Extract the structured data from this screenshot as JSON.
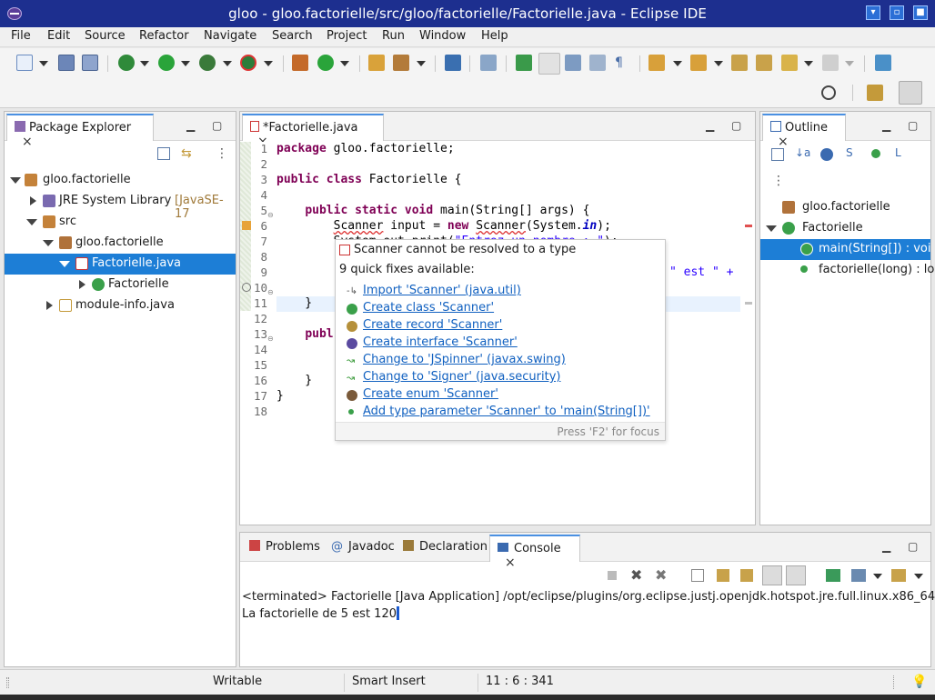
{
  "window": {
    "title": "gloo - gloo.factorielle/src/gloo/factorielle/Factorielle.java - Eclipse IDE"
  },
  "menu": [
    "File",
    "Edit",
    "Source",
    "Refactor",
    "Navigate",
    "Search",
    "Project",
    "Run",
    "Window",
    "Help"
  ],
  "package_explorer": {
    "tab_label": "Package Explorer",
    "tree": [
      {
        "label": "gloo.factorielle",
        "expanded": true
      },
      {
        "label": "JRE System Library",
        "suffix": "[JavaSE-17"
      },
      {
        "label": "src",
        "expanded": true
      },
      {
        "label": "gloo.factorielle",
        "expanded": true
      },
      {
        "label": "Factorielle.java",
        "selected": true
      },
      {
        "label": "Factorielle"
      },
      {
        "label": "module-info.java"
      }
    ]
  },
  "editor": {
    "tab_label": "*Factorielle.java",
    "line_numbers": [
      "1",
      "2",
      "3",
      "4",
      "5",
      "6",
      "7",
      "8",
      "9",
      "10",
      "11",
      "12",
      "13",
      "14",
      "15",
      "16",
      "17",
      "18"
    ],
    "partial_line9": "\" est \" +",
    "partial_line13": "publ"
  },
  "quick_fix": {
    "title": "Scanner cannot be resolved to a type",
    "subtitle": "9 quick fixes available:",
    "fixes": [
      "Import 'Scanner' (java.util)",
      "Create class 'Scanner'",
      "Create record 'Scanner'",
      "Create interface 'Scanner'",
      "Change to 'JSpinner' (javax.swing)",
      "Change to 'Signer' (java.security)",
      "Create enum 'Scanner'",
      "Add type parameter 'Scanner' to 'main(String[])'"
    ],
    "footer": "Press 'F2' for focus"
  },
  "outline": {
    "tab_label": "Outline",
    "items": [
      {
        "label": "gloo.factorielle"
      },
      {
        "label": "Factorielle"
      },
      {
        "label": "main(String[]) : voi",
        "selected": true
      },
      {
        "label": "factorielle(long) : lo"
      }
    ]
  },
  "bottom_tabs": {
    "problems": "Problems",
    "javadoc": "Javadoc",
    "declaration": "Declaration",
    "console": "Console"
  },
  "console": {
    "header": "<terminated> Factorielle [Java Application] /opt/eclipse/plugins/org.eclipse.justj.openjdk.hotspot.jre.full.linux.x86_64",
    "output": "La factorielle de 5 est 120"
  },
  "status": {
    "writable": "Writable",
    "insert_mode": "Smart Insert",
    "position": "11 : 6 : 341"
  }
}
